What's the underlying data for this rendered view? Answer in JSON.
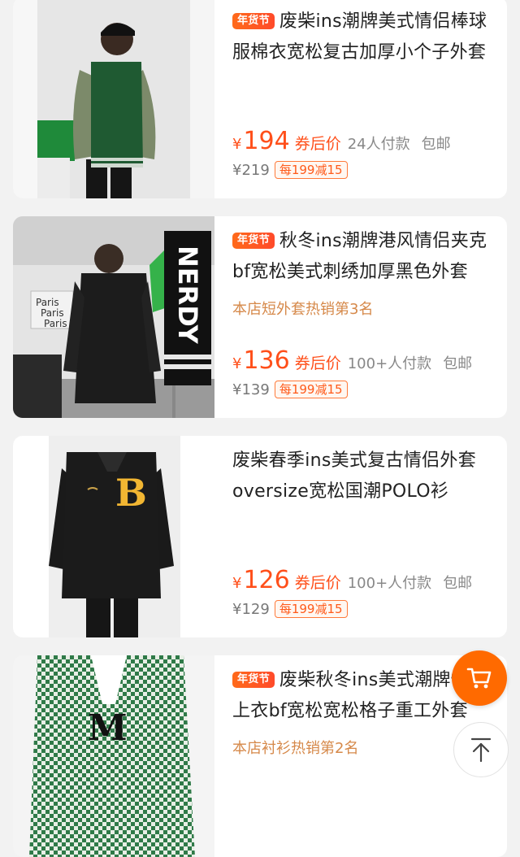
{
  "products": [
    {
      "badge": "年货节",
      "title": "废柴ins潮牌美式情侣棒球服棉衣宽松复古加厚小个子外套",
      "rank": "",
      "currency": "¥",
      "price": "194",
      "after_label": "券后价",
      "sold": "24人付款",
      "shipping": "包邮",
      "original_price": "¥219",
      "coupon": "每199减15",
      "image": "green-varsity-jacket"
    },
    {
      "badge": "年货节",
      "title": "秋冬ins潮牌港风情侣夹克bf宽松美式刺绣加厚黑色外套",
      "rank": "本店短外套热销第3名",
      "currency": "¥",
      "price": "136",
      "after_label": "券后价",
      "sold": "100+人付款",
      "shipping": "包邮",
      "original_price": "¥139",
      "coupon": "每199减15",
      "image": "black-embroidered-jacket",
      "image_texts": {
        "sign_1": "Paris",
        "sign_2": "Paris",
        "sign_3": "Paris",
        "banner": "NERDY"
      }
    },
    {
      "badge": "",
      "title": "废柴春季ins美式复古情侣外套oversize宽松国潮POLO衫",
      "rank": "",
      "currency": "¥",
      "price": "126",
      "after_label": "券后价",
      "sold": "100+人付款",
      "shipping": "包邮",
      "original_price": "¥129",
      "coupon": "每199减15",
      "image": "black-polo-sweatshirt",
      "image_texts": {
        "letter": "B"
      }
    },
    {
      "badge": "年货节",
      "title": "废柴秋冬ins美式潮牌情侣上衣bf宽松宽松格子重工外套",
      "rank": "本店衬衫热销第2名",
      "currency": "¥",
      "price": "",
      "after_label": "",
      "sold": "",
      "shipping": "",
      "original_price": "",
      "coupon": "",
      "image": "green-houndstooth-jacket",
      "image_texts": {
        "letter": "M"
      }
    }
  ],
  "floating": {
    "cart_icon": "cart-icon",
    "top_icon": "arrow-up-icon"
  },
  "colors": {
    "accent": "#ff4f1a",
    "badge": "#ff5a22",
    "rank": "#d6894a",
    "cart_fab": "#ff6a00",
    "background": "#f2f2f2"
  }
}
